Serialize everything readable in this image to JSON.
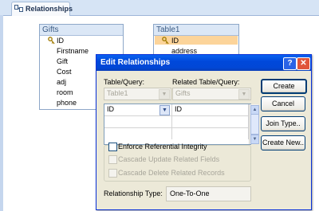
{
  "tab": {
    "label": "Relationships",
    "icon": "relationships-icon"
  },
  "tables": [
    {
      "title": "Gifts",
      "fields": [
        "ID",
        "Firstname",
        "Gift",
        "Cost",
        "adj",
        "room",
        "phone"
      ],
      "key_field": "ID"
    },
    {
      "title": "Table1",
      "fields": [
        "ID",
        "address"
      ],
      "key_field": "ID"
    }
  ],
  "dialog": {
    "title": "Edit Relationships",
    "help_label": "?",
    "close_label": "✕",
    "table_query_label": "Table/Query:",
    "related_table_query_label": "Related Table/Query:",
    "table_query_value": "Table1",
    "related_table_query_value": "Gifts",
    "grid_rows": [
      {
        "left": "ID",
        "right": "ID"
      },
      {
        "left": "",
        "right": ""
      },
      {
        "left": "",
        "right": ""
      }
    ],
    "buttons": {
      "create": "Create",
      "cancel": "Cancel",
      "join_type": "Join Type..",
      "create_new": "Create New.."
    },
    "enforce_label": "Enforce Referential Integrity",
    "cascade_update_label": "Cascade Update Related Fields",
    "cascade_delete_label": "Cascade Delete Related Records",
    "relationship_type_label": "Relationship Type:",
    "relationship_type_value": "One-To-One"
  },
  "colors": {
    "title_bar": "#0048db",
    "selection": "#fcd49a",
    "dialog_bg": "#ece9d8"
  }
}
